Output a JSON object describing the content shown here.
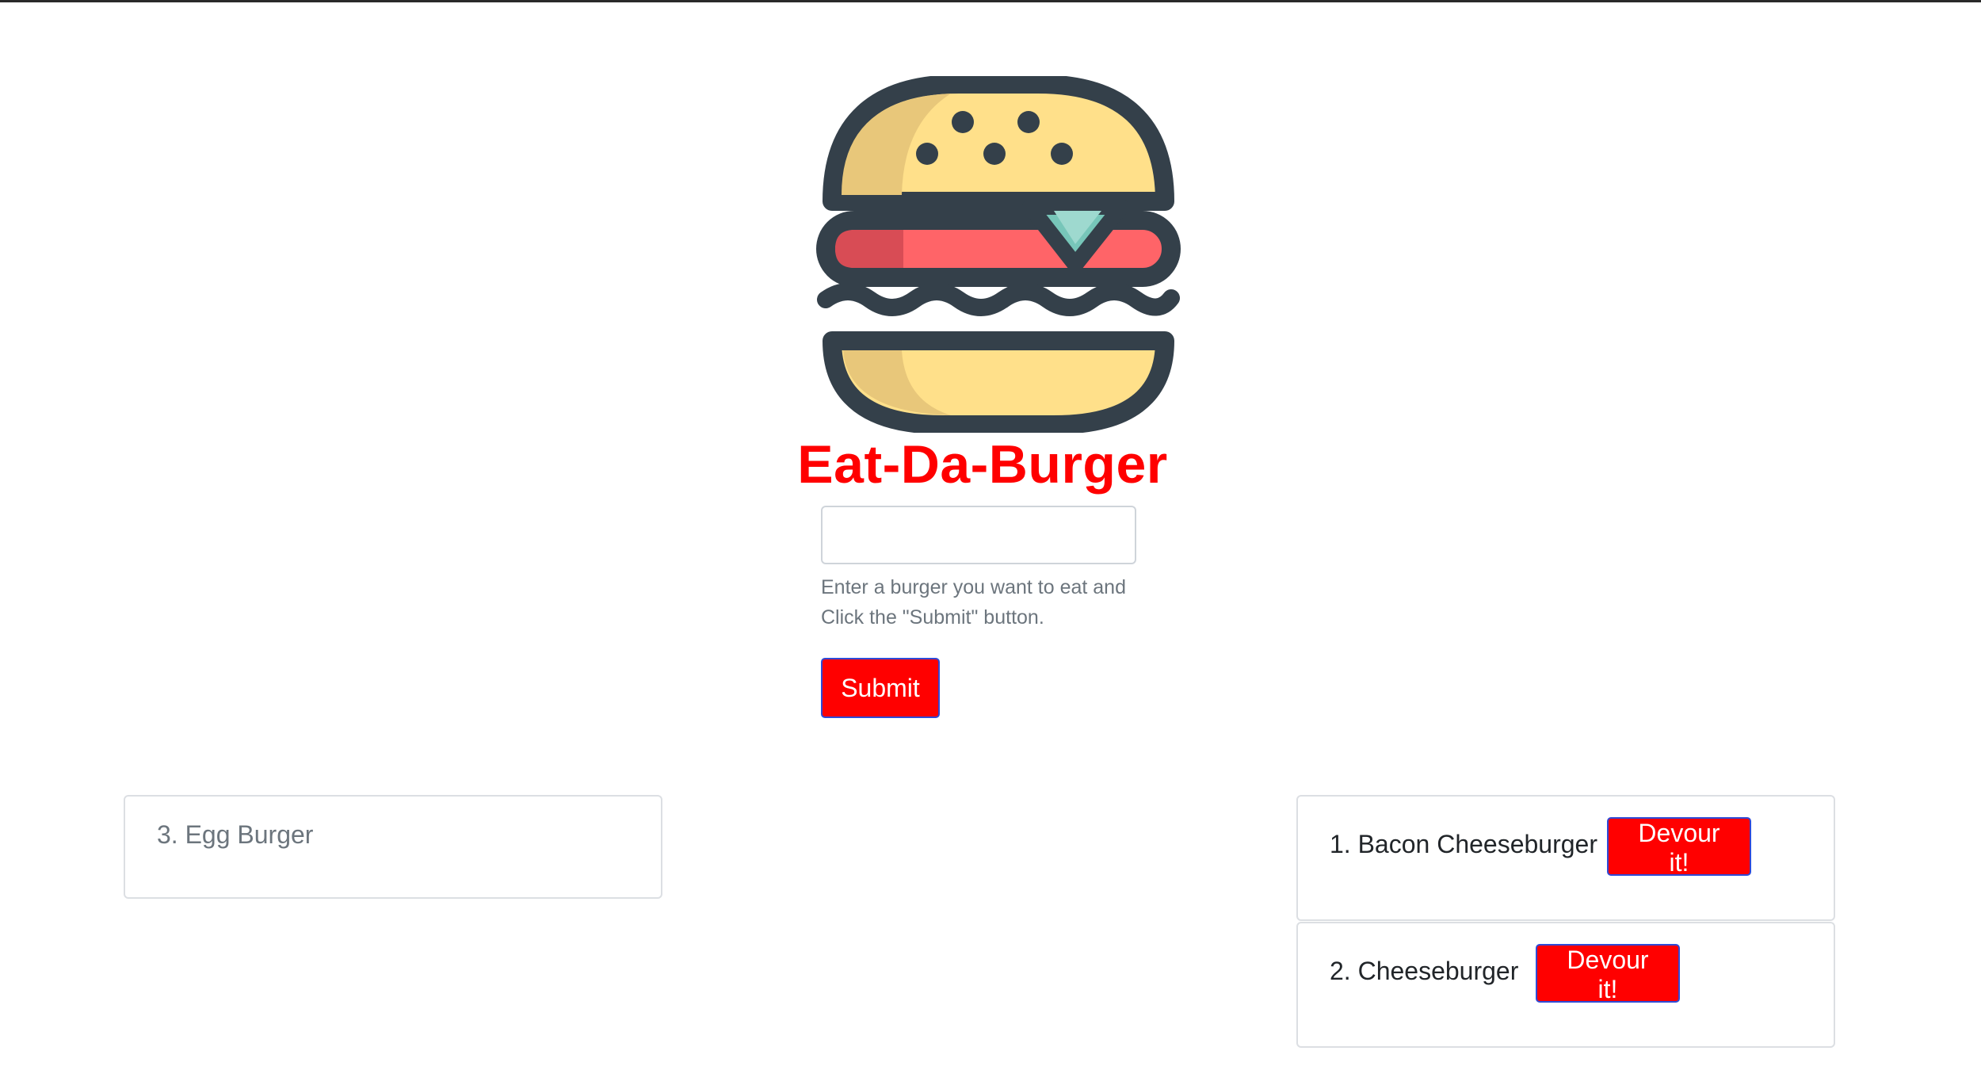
{
  "app": {
    "title": "Eat-Da-Burger"
  },
  "form": {
    "input_value": "",
    "help_text": "Enter a burger you want to eat and Click the \"Submit\" button.",
    "submit_label": "Submit"
  },
  "devoured": [
    {
      "label": "3. Egg Burger"
    }
  ],
  "burgers": [
    {
      "label": "1. Bacon Cheeseburger",
      "button": "Devour it!"
    },
    {
      "label": "2. Cheeseburger",
      "button": "Devour it!"
    }
  ],
  "colors": {
    "accent": "#ff0000",
    "button_border": "#2f4ad6",
    "bun": "#ffe08a",
    "bun_shadow": "#e8c77a",
    "patty": "#ff6468",
    "patty_shadow": "#d84c55",
    "cheese_triangle": "#77c6b9",
    "outline": "#34404a"
  },
  "icons": {
    "logo": "burger-logo-icon"
  }
}
